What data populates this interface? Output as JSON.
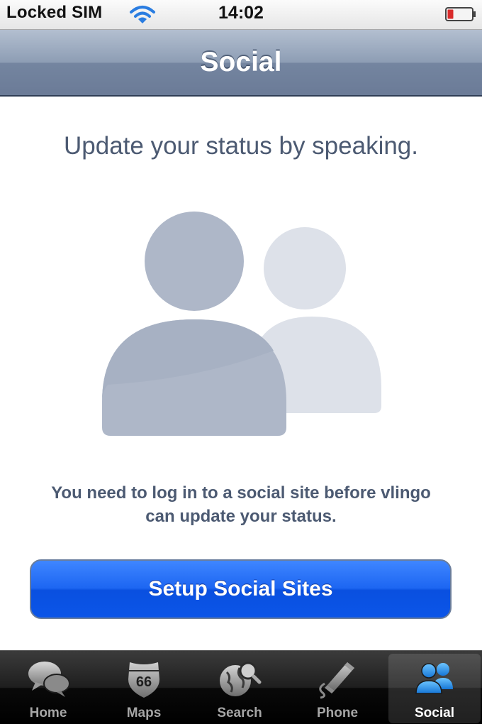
{
  "status_bar": {
    "carrier": "Locked SIM",
    "time": "14:02",
    "icons": [
      "wifi-icon",
      "battery-icon"
    ],
    "battery_color": "#d92b2b"
  },
  "nav": {
    "title": "Social"
  },
  "main": {
    "headline": "Update your status by speaking.",
    "illustration_icon": "people-icon",
    "message_line1": "You need to log in to a social site before vlingo",
    "message_line2": "can update your status.",
    "setup_button_label": "Setup Social Sites"
  },
  "colors": {
    "accent_button": "#1d66f2",
    "nav_bar": "#8d9db4",
    "text": "#4c5a72"
  },
  "tab_bar": {
    "tabs": [
      {
        "label": "Home",
        "icon": "speech-bubbles-icon",
        "active": false
      },
      {
        "label": "Maps",
        "icon": "route-shield-icon",
        "badge": "66",
        "active": false
      },
      {
        "label": "Search",
        "icon": "globe-search-icon",
        "active": false
      },
      {
        "label": "Phone",
        "icon": "phone-handset-icon",
        "active": false
      },
      {
        "label": "Social",
        "icon": "people-icon",
        "active": true
      }
    ]
  }
}
